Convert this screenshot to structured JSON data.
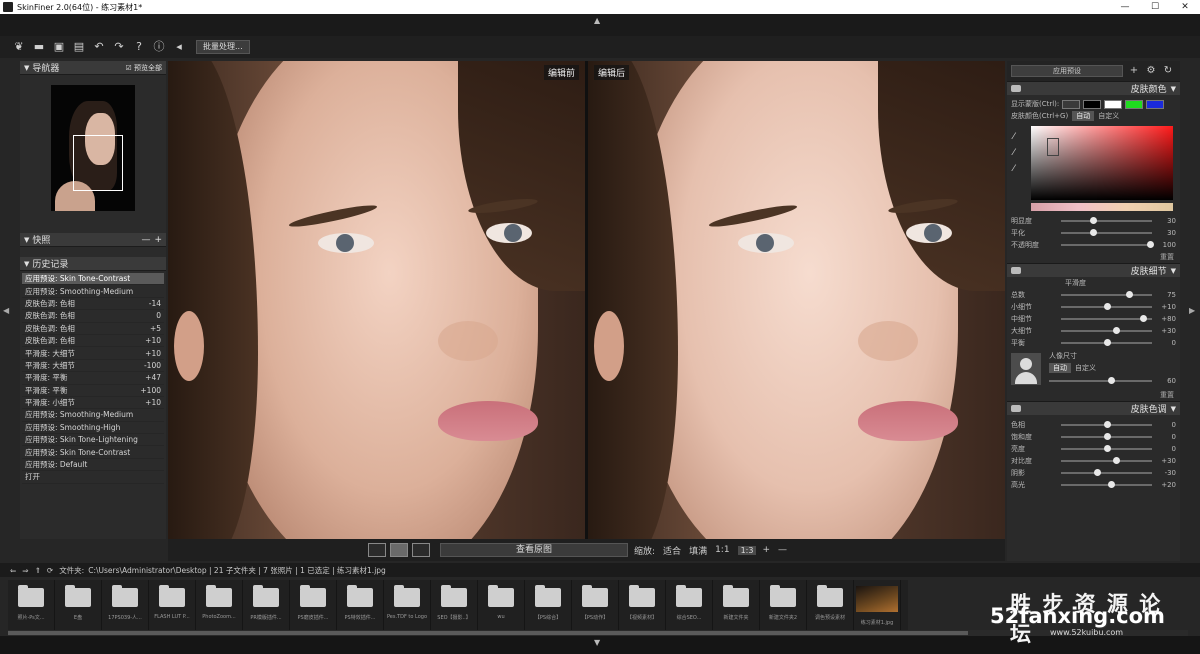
{
  "window": {
    "title": "SkinFiner 2.0(64位) - 练习素材1*",
    "buttons": [
      "—",
      "☐",
      "✕"
    ]
  },
  "toolbar": {
    "batch_label": "批量处理..."
  },
  "left": {
    "navigator_title": "导航器",
    "show_all_label": "预览全部",
    "snapshot_title": "快照",
    "history_title": "历史记录",
    "history": [
      {
        "label": "应用预设: Skin Tone-Contrast",
        "value": ""
      },
      {
        "label": "应用预设: Smoothing-Medium",
        "value": ""
      },
      {
        "label": "皮肤色调: 色相",
        "value": "-14"
      },
      {
        "label": "皮肤色调: 色相",
        "value": "0"
      },
      {
        "label": "皮肤色调: 色相",
        "value": "+5"
      },
      {
        "label": "皮肤色调: 色相",
        "value": "+10"
      },
      {
        "label": "平滑度: 大细节",
        "value": "+10"
      },
      {
        "label": "平滑度: 大细节",
        "value": "-100"
      },
      {
        "label": "平滑度: 平衡",
        "value": "+47"
      },
      {
        "label": "平滑度: 平衡",
        "value": "+100"
      },
      {
        "label": "平滑度: 小细节",
        "value": "+10"
      },
      {
        "label": "应用预设: Smoothing-Medium",
        "value": ""
      },
      {
        "label": "应用预设: Smoothing-High",
        "value": ""
      },
      {
        "label": "应用预设: Skin Tone-Lightening",
        "value": ""
      },
      {
        "label": "应用预设: Skin Tone-Contrast",
        "value": ""
      },
      {
        "label": "应用预设: Default",
        "value": ""
      },
      {
        "label": "打开",
        "value": ""
      }
    ]
  },
  "viewer": {
    "before_label": "编辑前",
    "after_label": "编辑后",
    "view_image_label": "查看原图",
    "zoom_label": "缩放:",
    "fit_label": "适合",
    "fill_label": "填满",
    "ratio_label": "1:1",
    "ratio_box": "1:3",
    "plus": "+",
    "minus": "—"
  },
  "right": {
    "preset_select": "应用预设",
    "skin_tone": {
      "title": "皮肤颜色",
      "show_mask_label": "显示蒙版(Ctrl):",
      "mask_color_label": "皮肤颜色(Ctrl+G)",
      "auto_label": "自动",
      "custom_label": "自定义",
      "swatch_colors": [
        "#3a3a3a",
        "#000000",
        "#ffffff",
        "#1fdc1f",
        "#1a2adc"
      ],
      "sliders": [
        {
          "label": "明显度",
          "value": "30",
          "pos": 0.35
        },
        {
          "label": "平化",
          "value": "30",
          "pos": 0.35
        },
        {
          "label": "不透明度",
          "value": "100",
          "pos": 0.98
        }
      ],
      "reset": "重置"
    },
    "skin_detail": {
      "title": "皮肤细节",
      "smooth_label": "平滑度",
      "sliders": [
        {
          "label": "总数",
          "value": "75",
          "pos": 0.75
        },
        {
          "label": "小细节",
          "value": "+10",
          "pos": 0.5
        },
        {
          "label": "中细节",
          "value": "+80",
          "pos": 0.9
        },
        {
          "label": "大细节",
          "value": "+30",
          "pos": 0.6
        },
        {
          "label": "平衡",
          "value": "0",
          "pos": 0.5
        }
      ],
      "portrait_label": "人像尺寸",
      "auto_label": "自动",
      "custom_label": "自定义",
      "portrait_slider": {
        "value": "60",
        "pos": 0.6
      },
      "reset": "重置"
    },
    "skin_color": {
      "title": "皮肤色调",
      "sliders": [
        {
          "label": "色相",
          "value": "0",
          "pos": 0.5
        },
        {
          "label": "饱和度",
          "value": "0",
          "pos": 0.5
        },
        {
          "label": "亮度",
          "value": "0",
          "pos": 0.5
        },
        {
          "label": "对比度",
          "value": "+30",
          "pos": 0.6
        },
        {
          "label": "阴影",
          "value": "-30",
          "pos": 0.4
        },
        {
          "label": "高光",
          "value": "+20",
          "pos": 0.55
        }
      ]
    }
  },
  "pathbar": {
    "label": "文件夹:",
    "path": "C:\\Users\\Administrator\\Desktop | 21 子文件夹 | 7 张照片 | 1 已选定 | 练习素材1.jpg"
  },
  "filmstrip": [
    "照片-Ps文...",
    "E盘",
    "17PS039-人...",
    "FLASH LUT P...",
    "PhotoZoom...",
    "PR模版插件...",
    "PS磨皮插件...",
    "PS特效插件...",
    "Pes.TDF to Logo",
    "SEO【摄影..】",
    "wu",
    "【PS综合】",
    "【PS动作】",
    "【视频素材】",
    "综合SEO...",
    "新建文件夹",
    "新建文件夹2",
    "调色预设素材",
    "练习素材1.jpg"
  ],
  "watermark": {
    "line1": "胜 步 资 源 论 坛",
    "line2": "52fanxing.com",
    "line3": "www.52kuibu.com"
  }
}
